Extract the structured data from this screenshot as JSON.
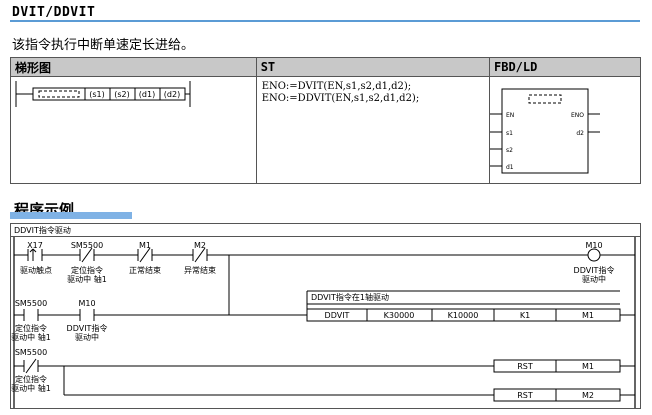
{
  "section": {
    "title": "DVIT/DDVIT",
    "description": "该指令执行中断单速定长进给。"
  },
  "format_table": {
    "headers": [
      "梯形图",
      "ST",
      "FBD/LD"
    ],
    "ladder_operands": [
      "(s1)",
      "(s2)",
      "(d1)",
      "(d2)"
    ],
    "st_lines": [
      "ENO:=DVIT(EN,s1,s2,d1,d2);",
      "ENO:=DDVIT(EN,s1,s2,d1,d2);"
    ],
    "fbd": {
      "inputs": [
        "EN",
        "s1",
        "s2",
        "d1"
      ],
      "outputs": [
        "ENO",
        "d2"
      ]
    }
  },
  "example": {
    "heading": "程序示例",
    "caption": "DDVIT指令驱动",
    "contacts_row1": [
      {
        "device": "X17",
        "comment": "驱动触点",
        "type": "rising"
      },
      {
        "device": "SM5500",
        "comment": "定位指令\n驱动中 轴1",
        "type": "nc"
      },
      {
        "device": "M1",
        "comment": "正常结束",
        "type": "nc"
      },
      {
        "device": "M2",
        "comment": "异常结束",
        "type": "nc"
      }
    ],
    "coil": {
      "device": "M10",
      "comment": "DDVIT指令\n驱动中"
    },
    "contacts_row2": [
      {
        "device": "SM5500",
        "comment": "定位指令\n驱动中 轴1",
        "type": "no"
      },
      {
        "device": "M10",
        "comment": "DDVIT指令\n驱动中",
        "type": "no"
      }
    ],
    "instruction_comment": "DDVIT指令在1轴驱动",
    "instruction": [
      "DDVIT",
      "K30000",
      "K10000",
      "K1",
      "M1"
    ],
    "contact_row3": {
      "device": "SM5500",
      "comment": "定位指令\n驱动中 轴1",
      "type": "nc"
    },
    "rst1": [
      "RST",
      "M1"
    ],
    "rst2": [
      "RST",
      "M2"
    ]
  }
}
